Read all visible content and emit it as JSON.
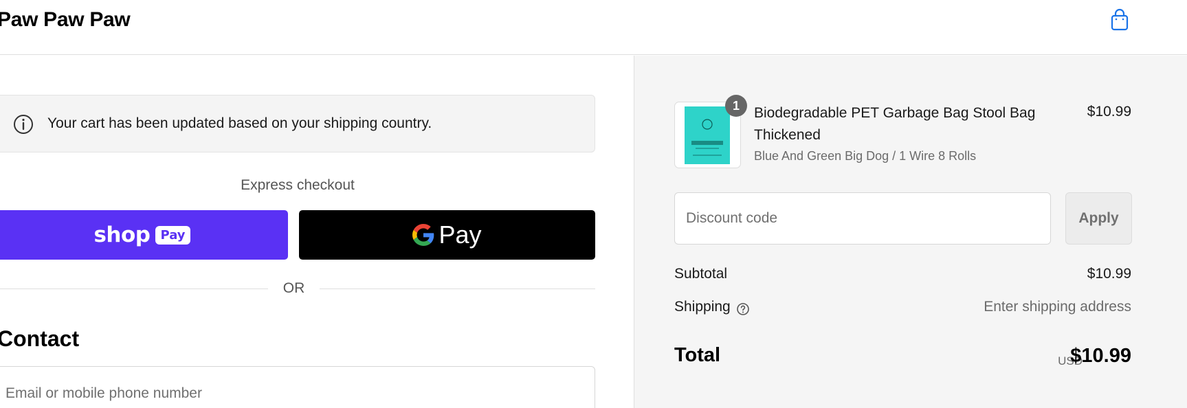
{
  "header": {
    "brand": "Paw Paw Paw"
  },
  "notice": {
    "message": "Your cart has been updated based on your shipping country."
  },
  "express": {
    "label": "Express checkout",
    "shop_pay": {
      "shop": "shop",
      "pay": "Pay"
    },
    "google_pay": {
      "pay": "Pay"
    },
    "or": "OR"
  },
  "contact": {
    "heading": "Contact",
    "email_placeholder": "Email or mobile phone number"
  },
  "cart": {
    "items": [
      {
        "title": "Biodegradable PET Garbage Bag Stool Bag Thickened",
        "variant": "Blue And Green Big Dog / 1 Wire 8 Rolls",
        "price": "$10.99",
        "quantity": "1"
      }
    ]
  },
  "discount": {
    "placeholder": "Discount code",
    "apply": "Apply"
  },
  "summary": {
    "subtotal_label": "Subtotal",
    "subtotal_value": "$10.99",
    "shipping_label": "Shipping",
    "shipping_value": "Enter shipping address",
    "total_label": "Total",
    "total_currency": "USD",
    "total_value": "$10.99"
  },
  "colors": {
    "shop_pay": "#5a31f4",
    "google_pay": "#000000",
    "summary_bg": "#f5f5f5",
    "cart_icon": "#1a73e8"
  },
  "icons": {
    "cart": "shopping-bag-icon",
    "info": "info-icon",
    "help": "question-circle-icon",
    "google": "google-g-icon"
  }
}
